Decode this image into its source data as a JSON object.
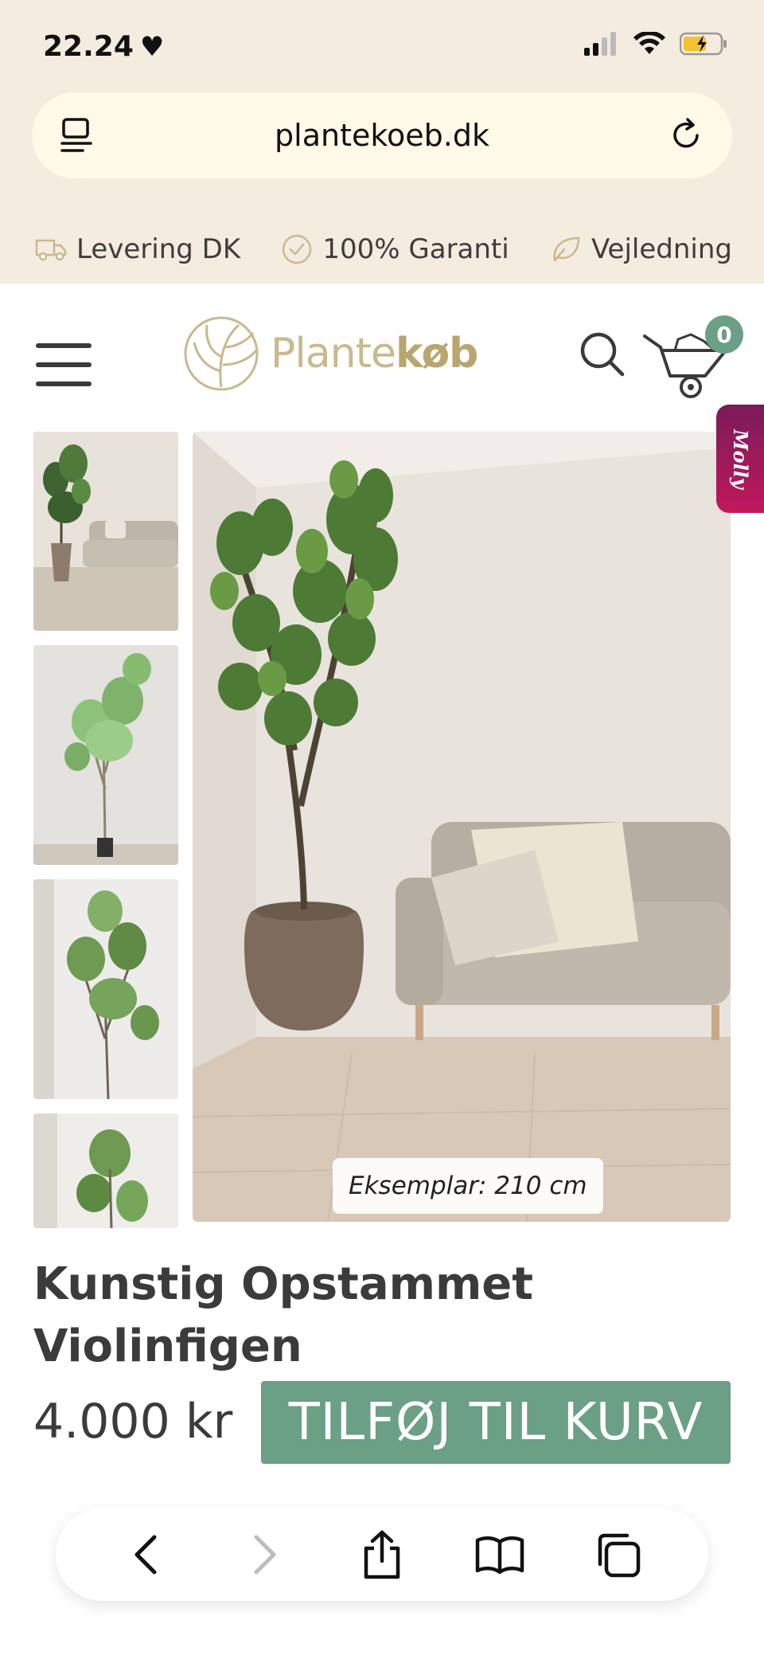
{
  "status_bar": {
    "time": "22.24",
    "heart": "♥"
  },
  "browser": {
    "url": "plantekoeb.dk"
  },
  "usp": [
    {
      "icon": "truck-icon",
      "label": "Levering DK"
    },
    {
      "icon": "check-circle-icon",
      "label": "100% Garanti"
    },
    {
      "icon": "chat-leaf-icon",
      "label": "Vejledning"
    }
  ],
  "header": {
    "logo_light": "Plante",
    "logo_bold": "køb",
    "cart_count": "0"
  },
  "chat_widget": {
    "label": "Molly"
  },
  "product": {
    "caption": "Eksemplar: 210 cm",
    "title": "Kunstig Opstammet Violinfigen",
    "price": "4.000 kr",
    "add_to_cart": "TILFØJ TIL KURV"
  },
  "colors": {
    "accent_green": "#6b9f86",
    "logo_gold": "#c9b98d",
    "top_background": "#f5ece0"
  }
}
